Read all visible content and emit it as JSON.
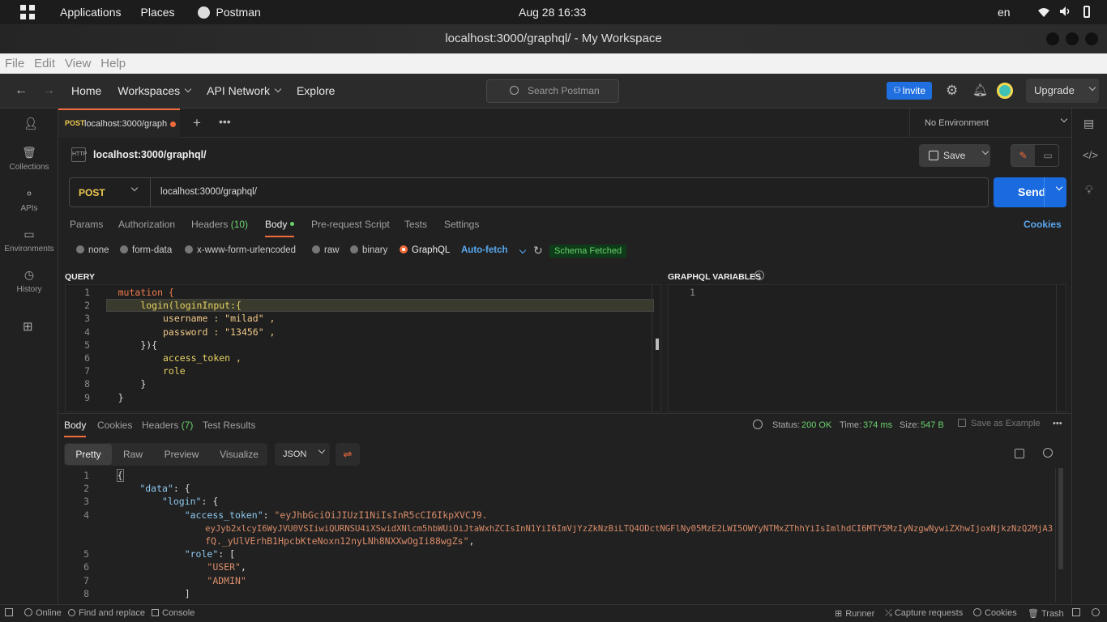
{
  "system": {
    "apps_label": "Applications",
    "places_label": "Places",
    "active_app": "Postman",
    "datetime": "Aug 28  16:33",
    "lang": "en"
  },
  "window": {
    "title": "localhost:3000/graphql/ - My Workspace"
  },
  "menu": [
    "File",
    "Edit",
    "View",
    "Help"
  ],
  "header": {
    "home": "Home",
    "workspaces": "Workspaces",
    "api_network": "API Network",
    "explore": "Explore",
    "search_placeholder": "Search Postman",
    "invite": "Invite",
    "upgrade": "Upgrade"
  },
  "sidebar": [
    {
      "label": "Collections",
      "icon": "collections-icon"
    },
    {
      "label": "APIs",
      "icon": "apis-icon"
    },
    {
      "label": "Environments",
      "icon": "environments-icon"
    },
    {
      "label": "History",
      "icon": "history-icon"
    }
  ],
  "tab": {
    "method": "POST",
    "title": "localhost:3000/graph"
  },
  "environment": "No Environment",
  "request": {
    "name": "localhost:3000/graphql/",
    "save": "Save",
    "method": "POST",
    "url": "localhost:3000/graphql/",
    "send": "Send",
    "cookies": "Cookies",
    "tabs": {
      "params": "Params",
      "authorization": "Authorization",
      "headers": "Headers",
      "headers_count": "(10)",
      "body": "Body",
      "prerequest": "Pre-request Script",
      "tests": "Tests",
      "settings": "Settings"
    },
    "body_types": [
      "none",
      "form-data",
      "x-www-form-urlencoded",
      "raw",
      "binary",
      "GraphQL"
    ],
    "auto_fetch": "Auto-fetch",
    "schema_status": "Schema Fetched",
    "query_label": "QUERY",
    "variables_label": "GRAPHQL VARIABLES",
    "variables_line": "1",
    "query_lines": [
      "mutation {",
      "    login(loginInput:{",
      "        username : \"milad\" ,",
      "        password : \"13456\" ,",
      "    }){",
      "        access_token ,",
      "        role",
      "    }",
      "}"
    ]
  },
  "response": {
    "tabs": {
      "body": "Body",
      "cookies": "Cookies",
      "headers": "Headers",
      "headers_count": "(7)",
      "tests": "Test Results"
    },
    "status_label": "Status:",
    "status": "200 OK",
    "time_label": "Time:",
    "time": "374 ms",
    "size_label": "Size:",
    "size": "547 B",
    "save_example": "Save as Example",
    "views": [
      "Pretty",
      "Raw",
      "Preview",
      "Visualize"
    ],
    "format": "JSON",
    "lines": [
      {
        "n": "1",
        "text": "{"
      },
      {
        "n": "2",
        "key": "\"data\"",
        "rest": ": {"
      },
      {
        "n": "3",
        "key": "\"login\"",
        "rest": ": {"
      },
      {
        "n": "4",
        "key": "\"access_token\"",
        "rest": ": ",
        "value": "\"eyJhbGciOiJIUzI1NiIsInR5cCI6IkpXVCJ9."
      },
      {
        "n": "",
        "value": "eyJyb2xlcyI6WyJVU0VSIiwiQURNSU4iXSwidXNlcm5hbWUiOiJtaWxhZCIsInN1YiI6ImVjYzZkNzBiLTQ4ODctNGFlNy05MzE2LWI5OWYyNTMxZThhYiIsImlhdCI6MTY5MzIyNzgwNywiZXhwIjoxNjkzNzQ2MjA3"
      },
      {
        "n": "",
        "value": "fQ._yUlVErhB1HpcbKteNoxn12nyLNh8NXXwOgIi88wgZs\"",
        "rest": ","
      },
      {
        "n": "5",
        "key": "\"role\"",
        "rest": ": ["
      },
      {
        "n": "6",
        "value": "\"USER\"",
        "rest": ","
      },
      {
        "n": "7",
        "value": "\"ADMIN\""
      },
      {
        "n": "8",
        "text": "]"
      }
    ]
  },
  "statusbar": {
    "online": "Online",
    "find": "Find and replace",
    "console": "Console",
    "runner": "Runner",
    "capture": "Capture requests",
    "cookies": "Cookies",
    "trash": "Trash"
  },
  "colors": {
    "accent": "#f26b3a",
    "primary": "#1a6be0",
    "success": "#6ad36e"
  }
}
